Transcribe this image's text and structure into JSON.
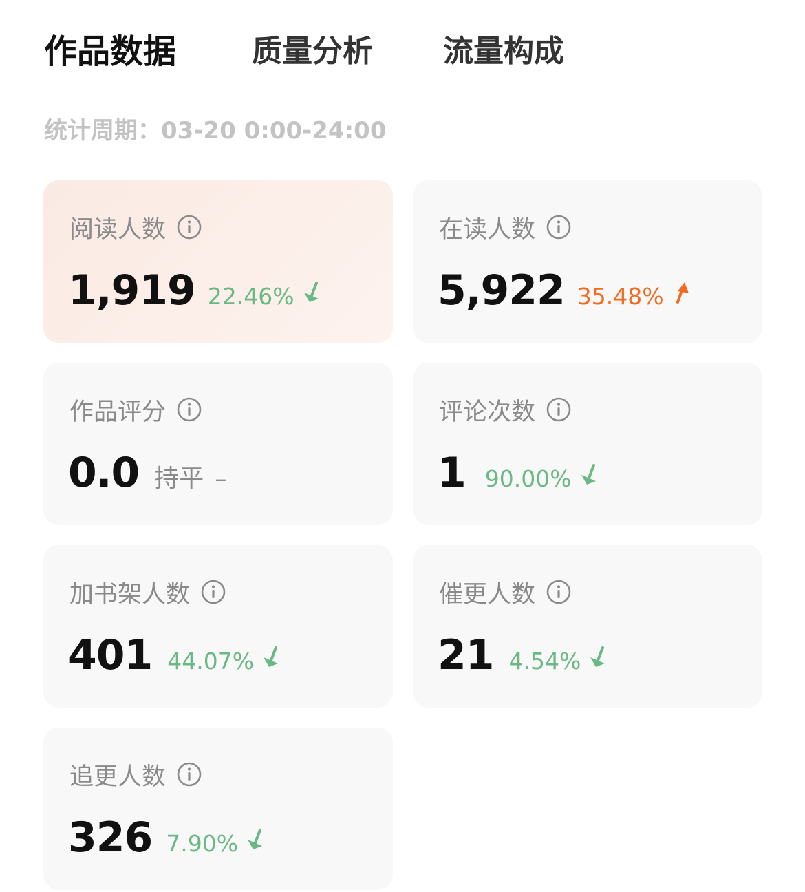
{
  "tabs": [
    {
      "label": "作品数据",
      "active": true
    },
    {
      "label": "质量分析",
      "active": false
    },
    {
      "label": "流量构成",
      "active": false
    }
  ],
  "period": {
    "text": "统计周期：03-20 0:00-24:00"
  },
  "colors": {
    "down": "#6ab884",
    "up": "#f26b21",
    "card_bg": "#f8f8f8",
    "highlight_bg": "#fcefe9"
  },
  "cards": [
    {
      "label": "阅读人数",
      "value": "1,919",
      "change": "22.46%",
      "trend": "down",
      "highlighted": true,
      "icon": "info-icon"
    },
    {
      "label": "在读人数",
      "value": "5,922",
      "change": "35.48%",
      "trend": "up",
      "highlighted": false,
      "icon": "info-icon"
    },
    {
      "label": "作品评分",
      "value": "0.0",
      "change": "持平",
      "trend": "flat",
      "dash": "–",
      "highlighted": false,
      "icon": "info-icon"
    },
    {
      "label": "评论次数",
      "value": "1",
      "change": "90.00%",
      "trend": "down",
      "highlighted": false,
      "icon": "info-icon"
    },
    {
      "label": "加书架人数",
      "value": "401",
      "change": "44.07%",
      "trend": "down",
      "highlighted": false,
      "icon": "info-icon"
    },
    {
      "label": "催更人数",
      "value": "21",
      "change": "4.54%",
      "trend": "down",
      "highlighted": false,
      "icon": "info-icon"
    },
    {
      "label": "追更人数",
      "value": "326",
      "change": "7.90%",
      "trend": "down",
      "highlighted": false,
      "icon": "info-icon"
    }
  ]
}
